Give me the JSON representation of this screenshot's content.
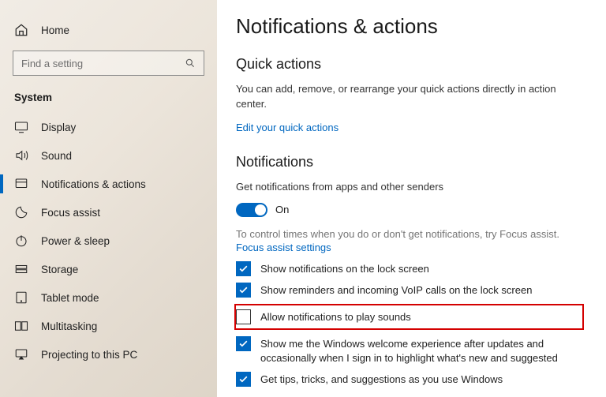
{
  "sidebar": {
    "home": "Home",
    "search_placeholder": "Find a setting",
    "section": "System",
    "items": [
      {
        "label": "Display"
      },
      {
        "label": "Sound"
      },
      {
        "label": "Notifications & actions"
      },
      {
        "label": "Focus assist"
      },
      {
        "label": "Power & sleep"
      },
      {
        "label": "Storage"
      },
      {
        "label": "Tablet mode"
      },
      {
        "label": "Multitasking"
      },
      {
        "label": "Projecting to this PC"
      }
    ]
  },
  "main": {
    "title": "Notifications & actions",
    "quick": {
      "heading": "Quick actions",
      "desc": "You can add, remove, or rearrange your quick actions directly in action center.",
      "edit_link": "Edit your quick actions"
    },
    "notif": {
      "heading": "Notifications",
      "toggle_label": "Get notifications from apps and other senders",
      "toggle_state": "On",
      "hint": "To control times when you do or don't get notifications, try Focus assist.",
      "focus_link": "Focus assist settings",
      "checks": [
        {
          "checked": true,
          "label": "Show notifications on the lock screen"
        },
        {
          "checked": true,
          "label": "Show reminders and incoming VoIP calls on the lock screen"
        },
        {
          "checked": false,
          "label": "Allow notifications to play sounds",
          "highlight": true
        },
        {
          "checked": true,
          "label": "Show me the Windows welcome experience after updates and occasionally when I sign in to highlight what's new and suggested"
        },
        {
          "checked": true,
          "label": "Get tips, tricks, and suggestions as you use Windows"
        }
      ]
    }
  }
}
